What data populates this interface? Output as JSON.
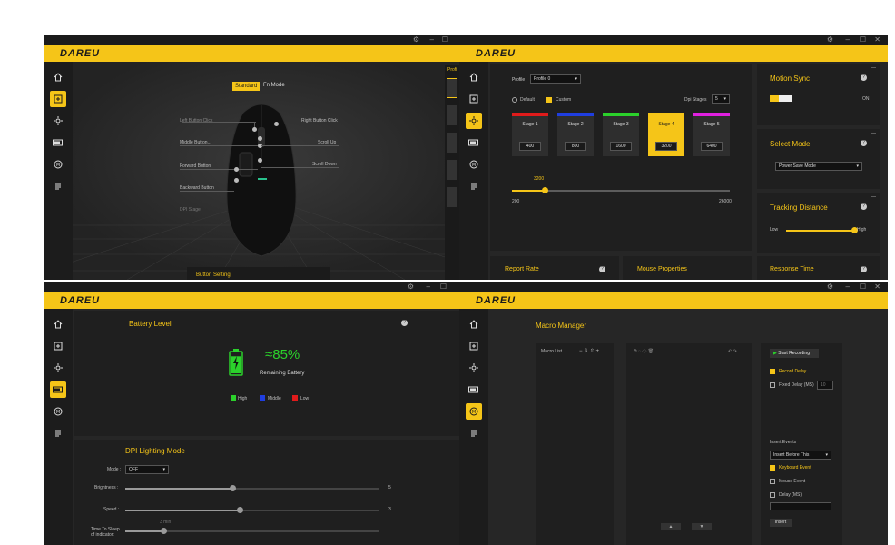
{
  "brand": "DAREU",
  "window_controls": {
    "settings": "⚙",
    "minimize": "–",
    "maximize": "☐",
    "close": "✕"
  },
  "colors": {
    "accent": "#f5c518",
    "panel": "#1f1f1f",
    "bg": "#262626"
  },
  "sidebar_icons": [
    "home-icon",
    "buttons-icon",
    "dpi-icon",
    "battery-icon",
    "macro-icon",
    "settings-list-icon"
  ],
  "button_setting": {
    "mode_standard": "Standard",
    "mode_fn": "Fn Mode",
    "left_labels": [
      "Left Button Click",
      "Middle Button...",
      "Forward Button",
      "Backward Button",
      "DPI Stage"
    ],
    "right_labels": [
      "Right Button Click",
      "Scroll Up",
      "Scroll Down"
    ],
    "footer": "Button Setting",
    "profile_tab": "Profi"
  },
  "dpi": {
    "profile_label": "Profile",
    "profile_value": "Profile 0",
    "default_label": "Default",
    "custom_label": "Custom",
    "stages_label": "Dpi Stages",
    "stages_value": "5",
    "stages": [
      {
        "name": "Stage 1",
        "value": "400",
        "color": "#e01b1b"
      },
      {
        "name": "Stage 2",
        "value": "800",
        "color": "#1f3ee0"
      },
      {
        "name": "Stage 3",
        "value": "1600",
        "color": "#2bd12b"
      },
      {
        "name": "Stage 4",
        "value": "3200",
        "color": "#f5c518"
      },
      {
        "name": "Stage 5",
        "value": "6400",
        "color": "#e020e0"
      }
    ],
    "slider_value": "3200",
    "slider_level": 0.15,
    "slider_min": "200",
    "slider_max": "26000",
    "motion_sync": "Motion Sync",
    "motion_sync_state": "ON",
    "select_mode": "Select Mode",
    "select_mode_value": "Power Save Mode",
    "tracking": "Tracking Distance",
    "tracking_low": "Low",
    "tracking_high": "High",
    "report_rate": "Report Rate",
    "mouse_properties": "Mouse Properties",
    "response_time": "Response Time"
  },
  "battery": {
    "title": "Battery Level",
    "percent": "≈85%",
    "level": 0.85,
    "remaining": "Remaining Battery",
    "legend": [
      {
        "label": "High",
        "color": "#2bd12b"
      },
      {
        "label": "Middle",
        "color": "#1f3ee0"
      },
      {
        "label": "Low",
        "color": "#e01b1b"
      }
    ],
    "lighting_title": "DPI Lighting Mode",
    "mode_label": "Mode :",
    "mode_value": "OFF",
    "brightness_label": "Brightness :",
    "brightness_value": "5",
    "brightness_level": 0.42,
    "speed_label": "Speed :",
    "speed_value": "3",
    "speed_level": 0.45,
    "sleep_label_1": "Time To Sleep",
    "sleep_label_2": "of indicator:",
    "sleep_value": "3 min",
    "sleep_level": 0.15
  },
  "macro": {
    "title": "Macro Manager",
    "list_title": "Macro List",
    "start_recording": "Start Recording",
    "record_delay": "Record Delay",
    "fixed_delay": "Fixed Delay (MS)",
    "fixed_delay_value": "10",
    "insert_events": "Insert Events",
    "insert_before": "Insert Before This",
    "keyboard_event": "Keyboard Event",
    "mouse_event": "Mouse Event",
    "delay_ms": "Delay (MS)",
    "insert": "Insert"
  }
}
